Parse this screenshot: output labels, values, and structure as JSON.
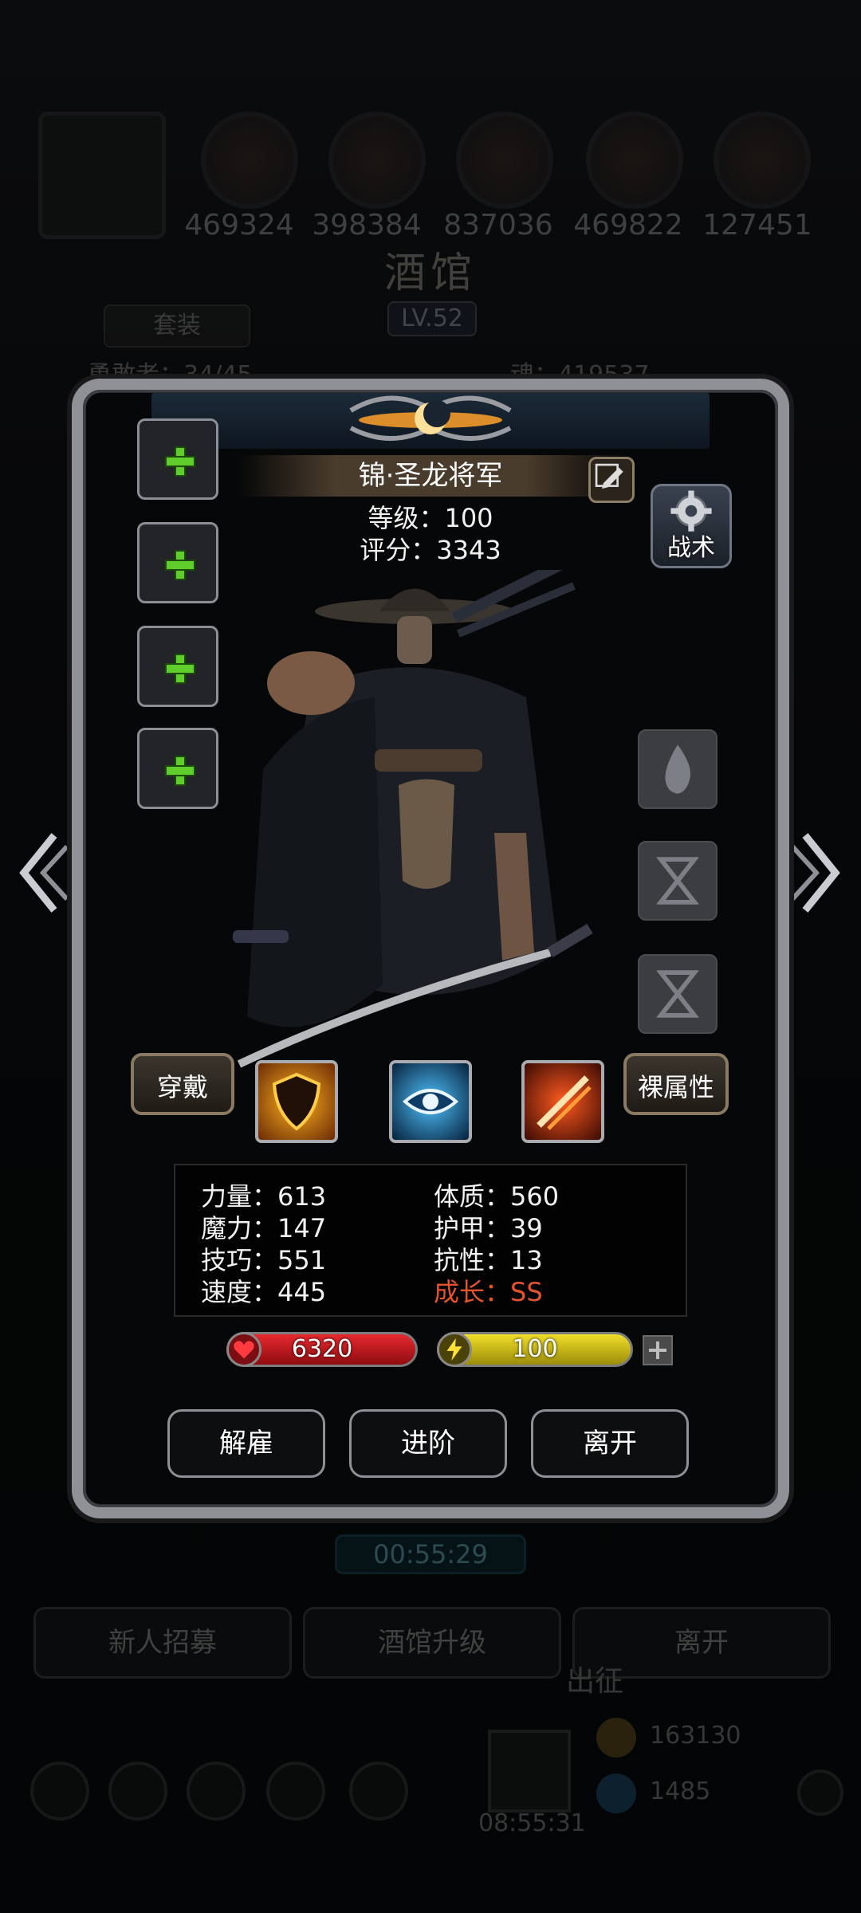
{
  "background": {
    "resources": [
      "469324",
      "398384",
      "837036",
      "469822",
      "127451"
    ],
    "title": "酒馆",
    "level": "LV.52",
    "suit_label": "套装",
    "hero_count_label": "勇敢者：34/45",
    "soul_label": "魂：419537",
    "timer": "00:55:29",
    "buttons": [
      "新人招募",
      "酒馆升级",
      "离开"
    ],
    "expedition_label": "出征",
    "expedition_cost_1": "163130",
    "expedition_cost_2": "1485",
    "bottom_timer": "08:55:31"
  },
  "dialog": {
    "hero_name": "锦·圣龙将军",
    "level_line": "等级：100",
    "score_line": "评分：3343",
    "tactics_label": "战术",
    "equip_button": "穿戴",
    "bare_attr_button": "裸属性",
    "stats": {
      "strength": "力量：613",
      "magic": "魔力：147",
      "skill": "技巧：551",
      "speed": "速度：445",
      "constitution": "体质：560",
      "armor": "护甲：39",
      "resistance": "抗性：13",
      "growth": "成长：SS"
    },
    "hp_value": "6320",
    "energy_value": "100",
    "actions": {
      "dismiss": "解雇",
      "advance": "进阶",
      "leave": "离开"
    },
    "colors": {
      "hp_bar": "#c4161c",
      "energy_bar": "#d8c81e",
      "growth_text": "#e2542c",
      "equip_plus": "#5fcd2a"
    }
  }
}
